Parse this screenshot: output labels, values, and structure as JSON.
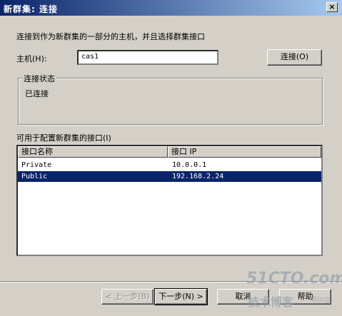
{
  "window": {
    "title": "新群集:  连接",
    "close_glyph": "×"
  },
  "intro": "连接到作为新群集的一部分的主机，并且选择群集接口",
  "host": {
    "label": "主机(H):",
    "value": "cas1",
    "connect_button": "连接(O)"
  },
  "status": {
    "group_label": "连接状态",
    "text": "已连接"
  },
  "interfaces": {
    "label": "可用于配置新群集的接口(I)",
    "columns": [
      "接口名称",
      "接口 IP"
    ],
    "rows": [
      {
        "name": "Private",
        "ip": "10.0.0.1",
        "selected": false
      },
      {
        "name": "Public",
        "ip": "192.168.2.24",
        "selected": true
      }
    ]
  },
  "buttons": {
    "back": "< 上一步(B)",
    "next": "下一步(N) >",
    "cancel": "取消",
    "help": "帮助"
  },
  "watermark": {
    "site": "51CTO.com",
    "sub": "技术博客",
    "tag": "Blog"
  }
}
